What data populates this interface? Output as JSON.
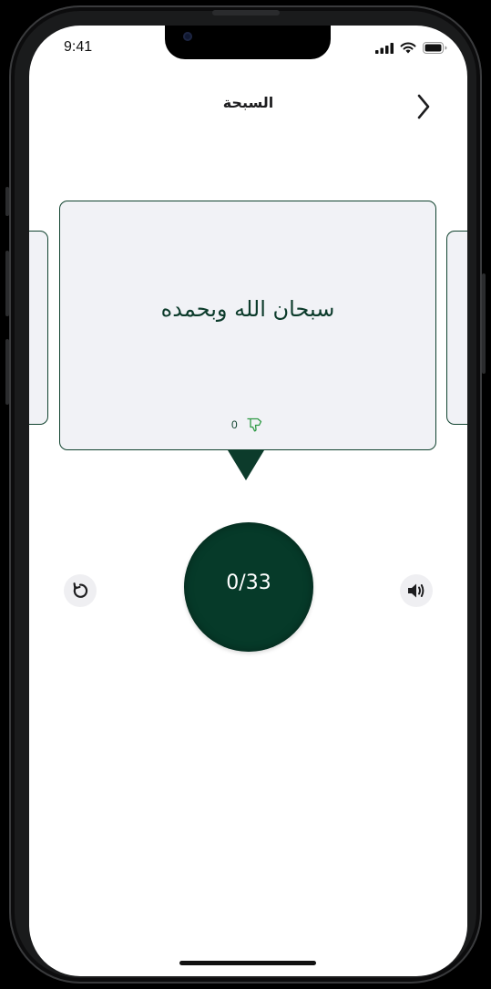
{
  "status_bar": {
    "time": "9:41",
    "icons": [
      "cellular-signal-icon",
      "wifi-icon",
      "battery-icon"
    ]
  },
  "header": {
    "title": "السبحة",
    "back_icon": "chevron-right-icon"
  },
  "card": {
    "dhikr": "سبحان الله وبحمده",
    "count": "0",
    "count_icon": "thumb-down-outline-icon"
  },
  "counter": {
    "label": "0/33"
  },
  "controls": {
    "reset_icon": "reset-arrow-icon",
    "sound_icon": "speaker-volume-icon"
  },
  "colors": {
    "accent": "#063a29",
    "card_background": "#f1f2f6",
    "card_border": "#11432f",
    "icon_green": "#2f9a45"
  }
}
